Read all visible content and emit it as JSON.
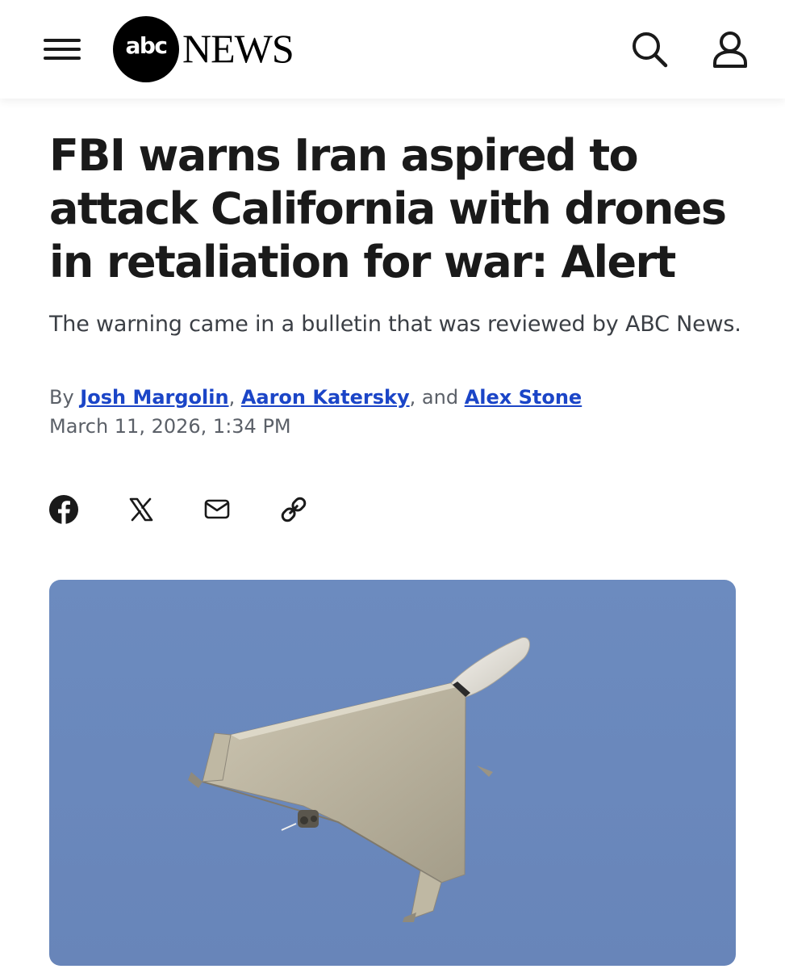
{
  "header": {
    "logo_abc": "abc",
    "logo_news": "NEWS",
    "menu_icon": "hamburger-menu-icon",
    "search_icon": "search-icon",
    "account_icon": "user-account-icon"
  },
  "article": {
    "headline": "FBI warns Iran aspired to attack California with drones in retaliation for war: Alert",
    "subheadline": "The warning came in a bulletin that was reviewed by ABC News.",
    "byline_prefix": "By ",
    "authors": [
      "Josh Margolin",
      "Aaron Katersky",
      "Alex Stone"
    ],
    "byline_sep1": ", ",
    "byline_sep2": ", and ",
    "date": "March 11, 2026, 1:34 PM"
  },
  "share": {
    "icons": [
      "facebook-icon",
      "x-icon",
      "email-icon",
      "link-icon"
    ]
  },
  "hero_image": {
    "subject": "delta-wing drone in flight against blue sky"
  },
  "colors": {
    "link": "#1b45c7",
    "text": "#1a1a1a",
    "muted": "#5b6068",
    "sky": "#6c8bbf"
  }
}
